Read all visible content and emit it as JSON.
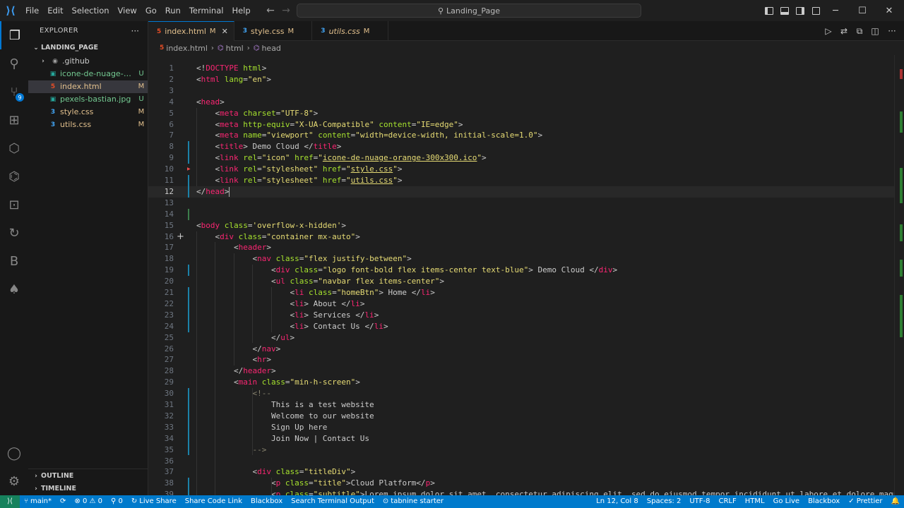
{
  "titlebar": {
    "menus": [
      "File",
      "Edit",
      "Selection",
      "View",
      "Go",
      "Run",
      "Terminal",
      "Help"
    ],
    "search_text": "Landing_Page"
  },
  "sidebar": {
    "title": "EXPLORER",
    "more": "···",
    "root_folder": "LANDING_PAGE",
    "files": [
      {
        "icon": "folder",
        "name": ".github",
        "status": "",
        "color": "#cccccc"
      },
      {
        "icon": "image",
        "name": "icone-de-nuage-or...",
        "status": "U",
        "color": "#73c991"
      },
      {
        "icon": "html",
        "name": "index.html",
        "status": "M",
        "color": "#e2c08d"
      },
      {
        "icon": "image",
        "name": "pexels-bastian.jpg",
        "status": "U",
        "color": "#73c991"
      },
      {
        "icon": "css",
        "name": "style.css",
        "status": "M",
        "color": "#e2c08d"
      },
      {
        "icon": "css",
        "name": "utils.css",
        "status": "M",
        "color": "#e2c08d"
      }
    ],
    "outline": "OUTLINE",
    "timeline": "TIMELINE",
    "scm_badge": "9"
  },
  "tabs": [
    {
      "name": "index.html",
      "status": "M",
      "active": true
    },
    {
      "name": "style.css",
      "status": "M",
      "active": false
    },
    {
      "name": "utils.css",
      "status": "M",
      "active": false
    }
  ],
  "breadcrumb": [
    "index.html",
    "html",
    "head"
  ],
  "editor": {
    "current_line": 12,
    "lines": [
      "<!DOCTYPE html>",
      "<html lang=\"en\">",
      "",
      "<head>",
      "    <meta charset=\"UTF-8\">",
      "    <meta http-equiv=\"X-UA-Compatible\" content=\"IE=edge\">",
      "    <meta name=\"viewport\" content=\"width=device-width, initial-scale=1.0\">",
      "    <title> Demo Cloud </title>",
      "    <link rel=\"icon\" href=\"icone-de-nuage-orange-300x300.ico\">",
      "    <link rel=\"stylesheet\" href=\"style.css\">",
      "    <link rel=\"stylesheet\" href=\"utils.css\">",
      "</head>",
      "",
      "",
      "<body class='overflow-x-hidden'>",
      "    <div class=\"container mx-auto\">",
      "        <header>",
      "            <nav class=\"flex justify-between\">",
      "                <div class=\"logo font-bold flex items-center text-blue\"> Demo Cloud </div>",
      "                <ul class=\"navbar flex items-center\">",
      "                    <li class=\"homeBtn\"> Home </li>",
      "                    <li> About </li>",
      "                    <li> Services </li>",
      "                    <li> Contact Us </li>",
      "                </ul>",
      "            </nav>",
      "            <hr>",
      "        </header>",
      "        <main class=\"min-h-screen\">",
      "            <!--",
      "                This is a test website",
      "                Welcome to our website",
      "                Sign Up here",
      "                Join Now | Contact Us",
      "            -->",
      "",
      "            <div class=\"titleDiv\">",
      "                <p class=\"title\">Cloud Platform</p>",
      "                <p class=\"subtitle\">Lorem ipsum dolor sit amet, consectetur adipiscing elit, sed do eiusmod tempor incididunt ut labore et dolore magna aliqua"
    ]
  },
  "statusbar": {
    "left": [
      "main*",
      "⟳",
      "⊗ 0 ⚠ 0",
      "⚲ 0",
      "Live Share",
      "Share Code Link",
      "Blackbox",
      "Search Terminal Output",
      "tabnine starter"
    ],
    "right": [
      "Ln 12, Col 8",
      "Spaces: 2",
      "UTF-8",
      "CRLF",
      "HTML",
      "Go Live",
      "Blackbox",
      "✓ Prettier",
      "🔔"
    ]
  }
}
